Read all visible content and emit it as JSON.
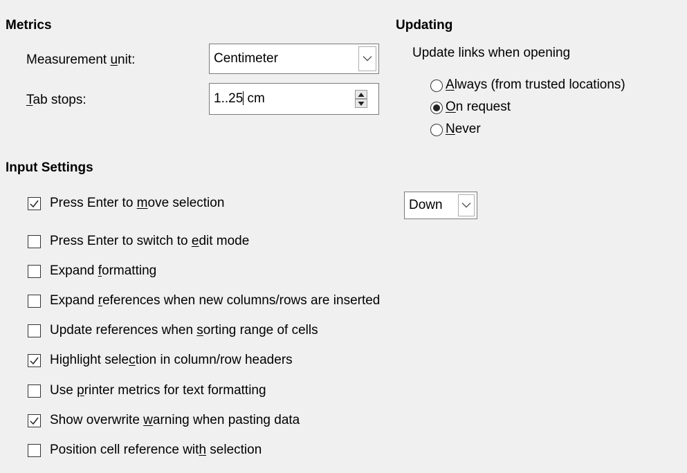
{
  "metrics": {
    "heading": "Metrics",
    "measurement_unit": {
      "label_pre": "Measurement ",
      "label_u": "u",
      "label_post": "nit:",
      "value": "Centimeter"
    },
    "tab_stops": {
      "label_u": "T",
      "label_post": "ab stops:",
      "value_before_caret": "1..25",
      "value_after_caret": " cm"
    }
  },
  "updating": {
    "heading": "Updating",
    "update_links_label": "Update links when opening",
    "options": [
      {
        "pre": "",
        "u": "A",
        "post": "lways (from trusted locations)",
        "selected": false
      },
      {
        "pre": "",
        "u": "O",
        "post": "n request",
        "selected": true
      },
      {
        "pre": "",
        "u": "N",
        "post": "ever",
        "selected": false
      }
    ]
  },
  "input_settings": {
    "heading": "Input Settings",
    "move_direction": "Down",
    "checkboxes": [
      {
        "pre": "Press Enter to ",
        "u": "m",
        "post": "ove selection",
        "checked": true
      },
      {
        "pre": "Press Enter to switch to ",
        "u": "e",
        "post": "dit mode",
        "checked": false
      },
      {
        "pre": "Expand ",
        "u": "f",
        "post": "ormatting",
        "checked": false
      },
      {
        "pre": "Expand ",
        "u": "r",
        "post": "eferences when new columns/rows are inserted",
        "checked": false
      },
      {
        "pre": "Update references when ",
        "u": "s",
        "post": "orting range of cells",
        "checked": false
      },
      {
        "pre": "Highlight sele",
        "u": "c",
        "post": "tion in column/row headers",
        "checked": true
      },
      {
        "pre": "Use ",
        "u": "p",
        "post": "rinter metrics for text formatting",
        "checked": false
      },
      {
        "pre": "Show overwrite ",
        "u": "w",
        "post": "arning when pasting data",
        "checked": true
      },
      {
        "pre": "Position cell reference wit",
        "u": "h",
        "post": " selection",
        "checked": false
      }
    ]
  }
}
